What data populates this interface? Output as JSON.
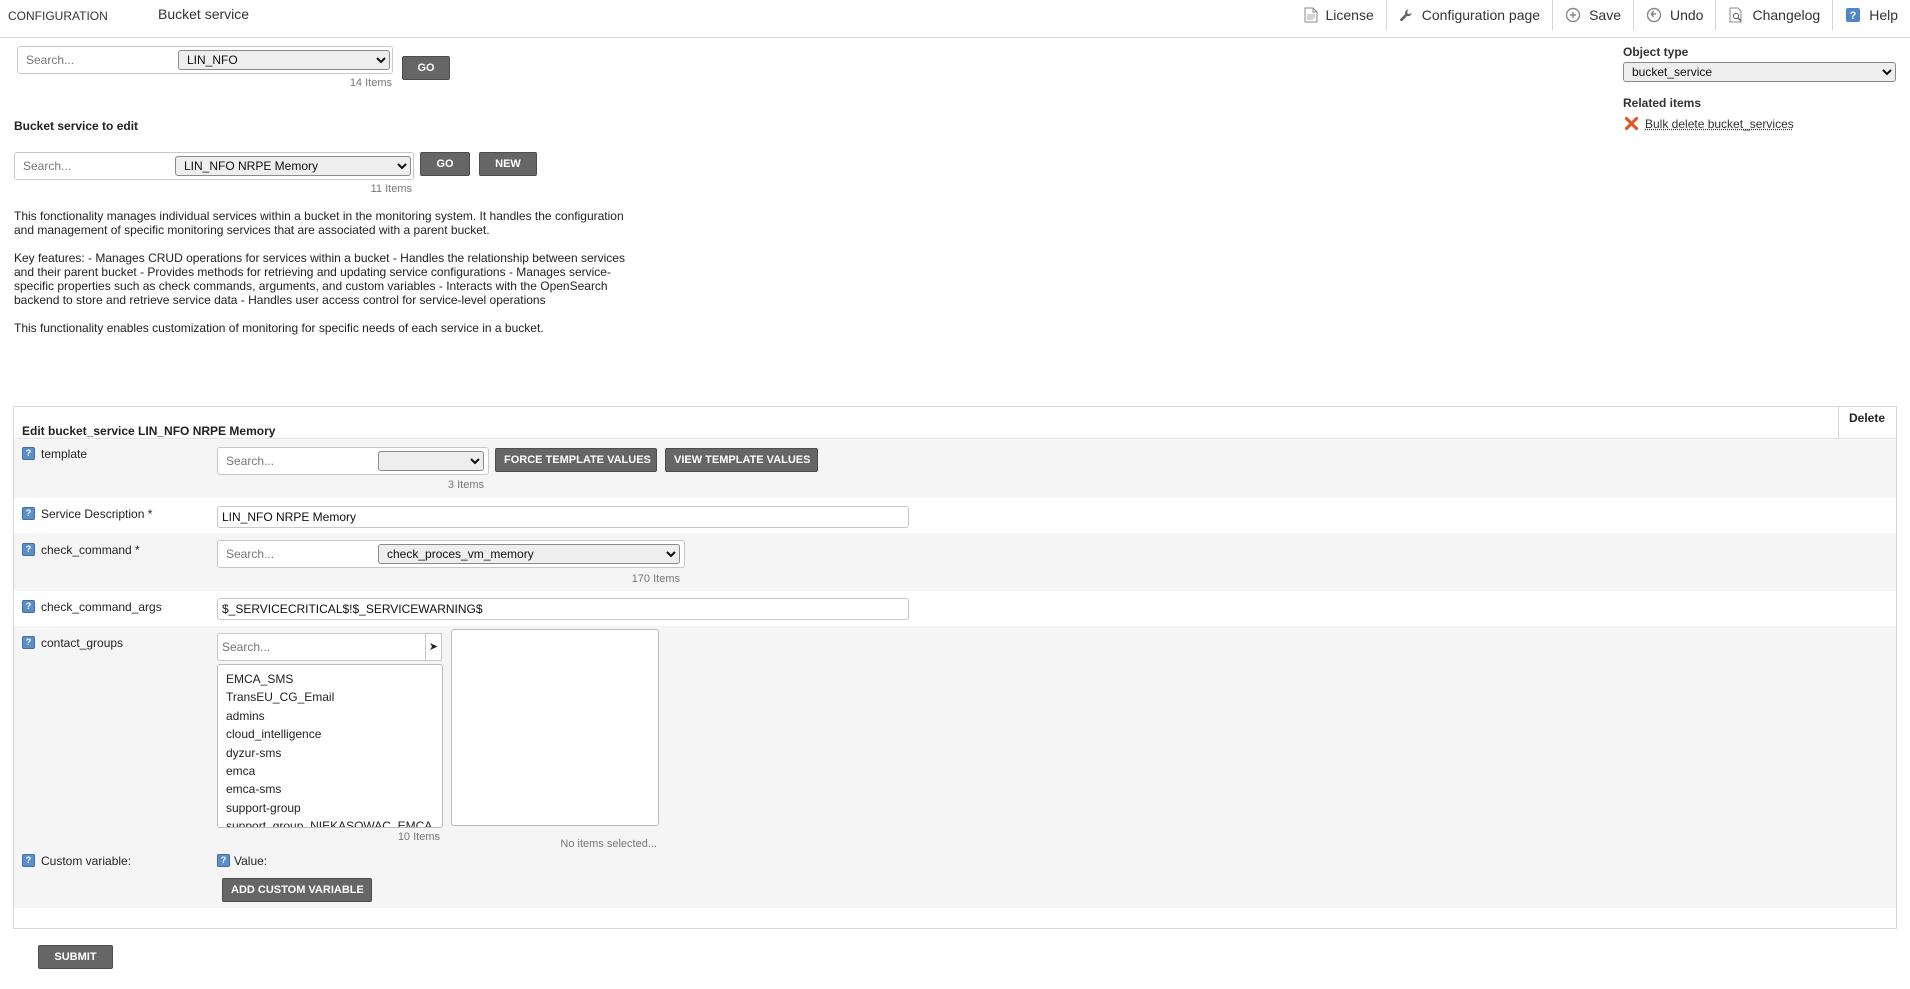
{
  "header": {
    "section": "CONFIGURATION",
    "title": "Bucket service",
    "actions": [
      {
        "label": "License",
        "icon": "document-icon"
      },
      {
        "label": "Configuration page",
        "icon": "wrench-icon"
      },
      {
        "label": "Save",
        "icon": "save-icon"
      },
      {
        "label": "Undo",
        "icon": "undo-icon"
      },
      {
        "label": "Changelog",
        "icon": "changelog-icon"
      },
      {
        "label": "Help",
        "icon": "help-icon"
      }
    ]
  },
  "bucket_search": {
    "placeholder": "Search...",
    "selected": "LIN_NFO",
    "count": "14 Items",
    "go_label": "GO"
  },
  "service_section": {
    "heading": "Bucket service to edit",
    "search_placeholder": "Search...",
    "selected": "LIN_NFO NRPE Memory",
    "count": "11 Items",
    "go_label": "GO",
    "new_label": "NEW"
  },
  "description": [
    "This fonctionality manages individual services within a bucket in the monitoring system. It handles the configuration and management of specific monitoring services that are associated with a parent bucket.",
    "Key features: - Manages CRUD operations for services within a bucket - Handles the relationship between services and their parent bucket - Provides methods for retrieving and updating service configurations - Manages service-specific properties such as check commands, arguments, and custom variables - Interacts with the OpenSearch backend to store and retrieve service data - Handles user access control for service-level operations",
    "This functionality enables customization of monitoring for specific needs of each service in a bucket."
  ],
  "right_panel": {
    "object_type_label": "Object type",
    "object_type_value": "bucket_service",
    "related_label": "Related items",
    "bulk_delete_label": "Bulk delete bucket_services"
  },
  "form": {
    "title": "Edit bucket_service LIN_NFO NRPE Memory",
    "delete_label": "Delete",
    "help_glyph": "?",
    "template": {
      "label": "template",
      "placeholder": "Search...",
      "count": "3 Items",
      "force_label": "FORCE TEMPLATE VALUES",
      "view_label": "VIEW TEMPLATE VALUES"
    },
    "service_description": {
      "label": "Service Description *",
      "value": "LIN_NFO NRPE Memory"
    },
    "check_command": {
      "label": "check_command *",
      "placeholder": "Search...",
      "selected": "check_proces_vm_memory",
      "count": "170 Items"
    },
    "check_command_args": {
      "label": "check_command_args",
      "value": "$_SERVICECRITICAL$!$_SERVICEWARNING$"
    },
    "contact_groups": {
      "label": "contact_groups",
      "placeholder": "Search...",
      "move_glyph": "➤",
      "options": [
        "EMCA_SMS",
        "TransEU_CG_Email",
        "admins",
        "cloud_intelligence",
        "dyzur-sms",
        "emca",
        "emca-sms",
        "support-group",
        "support_group_NIEKASOWAC_EMCA"
      ],
      "count": "10 Items",
      "selected_note": "No items selected..."
    },
    "custom_variable": {
      "label": "Custom variable:",
      "value_label": "Value:",
      "add_label": "ADD CUSTOM VARIABLE"
    }
  },
  "submit_label": "SUBMIT"
}
